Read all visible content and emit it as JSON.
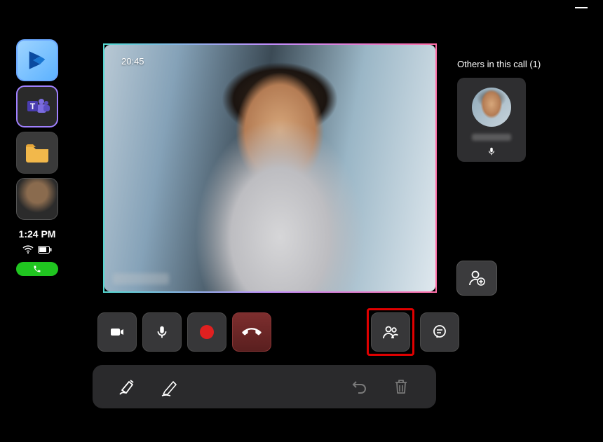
{
  "sidebar": {
    "dynamics_icon": "dynamics-365-icon",
    "teams_icon": "teams-icon",
    "folder_icon": "folder-icon",
    "avatar_name": "avatar",
    "time": "1:24 PM",
    "wifi_icon": "wifi-icon",
    "battery_icon": "battery-icon",
    "call_pill_icon": "phone-icon"
  },
  "video": {
    "duration": "20:45",
    "participant_name_blurred": true
  },
  "right_panel": {
    "label": "Others in this call (1)",
    "participant_mic_icon": "mic-icon",
    "add_person_icon": "add-person-icon"
  },
  "controls": {
    "camera_icon": "camera-icon",
    "mic_icon": "mic-icon",
    "record_icon": "record-icon",
    "end_call_icon": "end-call-icon",
    "people_icon": "people-icon",
    "chat_icon": "chat-icon"
  },
  "tools": {
    "eraser_icon": "eraser-icon",
    "pen_icon": "pen-icon",
    "undo_icon": "undo-icon",
    "delete_icon": "delete-icon"
  }
}
